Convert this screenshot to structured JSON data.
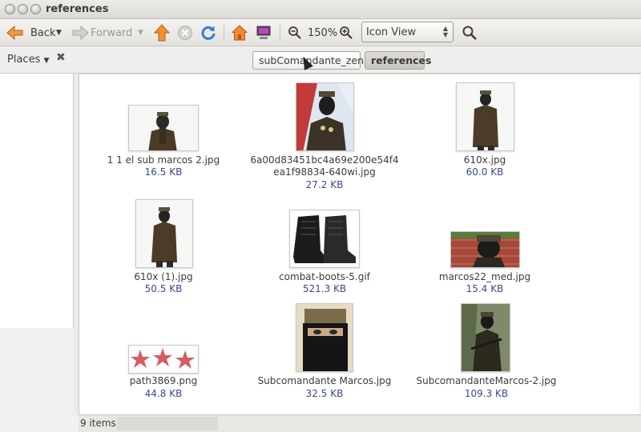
{
  "window": {
    "title": "references"
  },
  "toolbar": {
    "back_label": "Back",
    "forward_label": "Forward",
    "zoom_level": "150%",
    "view_mode": "Icon View"
  },
  "sidebar": {
    "title": "Places"
  },
  "pathbar": {
    "crumbs": [
      "subComandante_zen",
      "references"
    ]
  },
  "files": [
    {
      "name": "1 1  el sub marcos 2.jpg",
      "size": "16.5 KB"
    },
    {
      "name_line1": "6a00d83451bc4a69e200e54f4",
      "name_line2": "ea1f98834-640wi.jpg",
      "size": "27.2 KB"
    },
    {
      "name": "610x.jpg",
      "size": "60.0 KB"
    },
    {
      "name": "610x (1).jpg",
      "size": "50.5 KB"
    },
    {
      "name": "combat-boots-5.gif",
      "size": "521.3 KB"
    },
    {
      "name": "marcos22_med.jpg",
      "size": "15.4 KB"
    },
    {
      "name": "path3869.png",
      "size": "44.8 KB"
    },
    {
      "name": "Subcomandante Marcos.jpg",
      "size": "32.5 KB"
    },
    {
      "name": "SubcomandanteMarcos-2.jpg",
      "size": "109.3 KB"
    }
  ],
  "status": {
    "text": "9 items,"
  },
  "colors": {
    "accent_orange": "#e8731e",
    "size_text": "#3b4a8f"
  }
}
